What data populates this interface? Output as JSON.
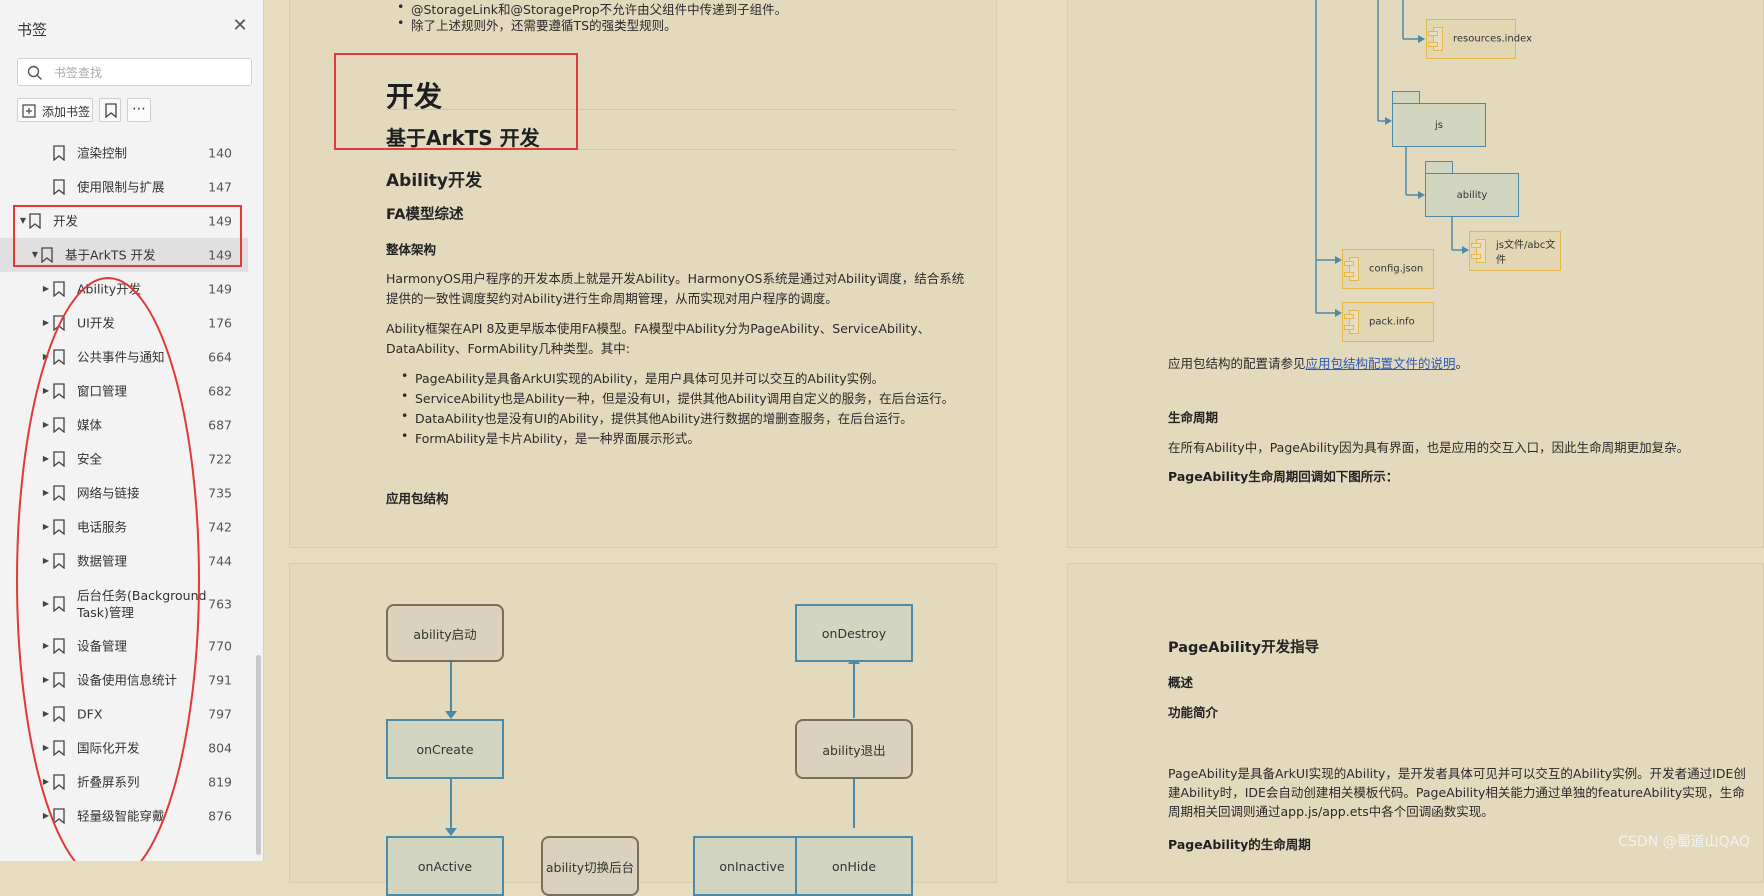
{
  "sidebar": {
    "title": "书签",
    "close_icon": "close-icon",
    "search_placeholder": "书签查找",
    "toolbar": {
      "add_label": "添加书签",
      "more_label": "⋯"
    },
    "items": [
      {
        "label": "渲染控制",
        "page": "140",
        "level": 1,
        "arrow": ""
      },
      {
        "label": "使用限制与扩展",
        "page": "147",
        "level": 1,
        "arrow": ""
      },
      {
        "label": "开发",
        "page": "149",
        "level": 0,
        "arrow": "▼"
      },
      {
        "label": "基于ArkTS 开发",
        "page": "149",
        "level": 1,
        "arrow": "▼",
        "selected": true
      },
      {
        "label": "Ability开发",
        "page": "149",
        "level": 2,
        "arrow": "▶"
      },
      {
        "label": "UI开发",
        "page": "176",
        "level": 2,
        "arrow": "▶"
      },
      {
        "label": "公共事件与通知",
        "page": "664",
        "level": 2,
        "arrow": "▶"
      },
      {
        "label": "窗口管理",
        "page": "682",
        "level": 2,
        "arrow": "▶"
      },
      {
        "label": "媒体",
        "page": "687",
        "level": 2,
        "arrow": "▶"
      },
      {
        "label": "安全",
        "page": "722",
        "level": 2,
        "arrow": "▶"
      },
      {
        "label": "网络与链接",
        "page": "735",
        "level": 2,
        "arrow": "▶"
      },
      {
        "label": "电话服务",
        "page": "742",
        "level": 2,
        "arrow": "▶"
      },
      {
        "label": "数据管理",
        "page": "744",
        "level": 2,
        "arrow": "▶"
      },
      {
        "label": "后台任务(Background",
        "label2": "Task)管理",
        "page": "763",
        "level": 2,
        "arrow": "▶"
      },
      {
        "label": "设备管理",
        "page": "770",
        "level": 2,
        "arrow": "▶"
      },
      {
        "label": "设备使用信息统计",
        "page": "791",
        "level": 2,
        "arrow": "▶"
      },
      {
        "label": "DFX",
        "page": "797",
        "level": 2,
        "arrow": "▶"
      },
      {
        "label": "国际化开发",
        "page": "804",
        "level": 2,
        "arrow": "▶"
      },
      {
        "label": "折叠屏系列",
        "page": "819",
        "level": 2,
        "arrow": "▶"
      },
      {
        "label": "轻量级智能穿戴",
        "page": "876",
        "level": 2,
        "arrow": "▶"
      }
    ]
  },
  "page1": {
    "top_line1": "@StorageLink和@StorageProp不允许由父组件中传递到子组件。",
    "top_line2": "除了上述规则外，还需要遵循TS的强类型规则。",
    "h_dev": "开发",
    "h_arkts": "基于ArkTS 开发",
    "h_ability": "Ability开发",
    "h_fa": "FA模型综述",
    "h_arch": "整体架构",
    "p1_l1": "HarmonyOS用户程序的开发本质上就是开发Ability。HarmonyOS系统是通过对Ability调度，结合系统",
    "p1_l2": "提供的一致性调度契约对Ability进行生命周期管理，从而实现对用户程序的调度。",
    "p2_l1": "Ability框架在API 8及更早版本使用FA模型。FA模型中Ability分为PageAbility、ServiceAbility、",
    "p2_l2": "DataAbility、FormAbility几种类型。其中:",
    "bullets": [
      "PageAbility是具备ArkUI实现的Ability，是用户具体可见并可以交互的Ability实例。",
      "ServiceAbility也是Ability一种，但是没有UI，提供其他Ability调用自定义的服务，在后台运行。",
      "DataAbility也是没有UI的Ability，提供其他Ability进行数据的增删查服务，在后台运行。",
      "FormAbility是卡片Ability，是一种界面展示形式。"
    ],
    "h_pkg": "应用包结构"
  },
  "page2": {
    "nodes": {
      "resources_index": "resources.index",
      "js": "js",
      "ability": "ability",
      "config": "config.json",
      "abc": "js文件/abc文件",
      "pack": "pack.info"
    },
    "pkg_note_prefix": "应用包结构的配置请参见",
    "pkg_note_link": "应用包结构配置文件的说明",
    "pkg_note_suffix": "。",
    "h_lifecycle": "生命周期",
    "lifecycle_text": "在所有Ability中，PageAbility因为具有界面，也是应用的交互入口，因此生命周期更加复杂。",
    "lifecycle_fig": "PageAbility生命周期回调如下图所示："
  },
  "page3": {
    "nodes": {
      "start": "ability启动",
      "create": "onCreate",
      "destroy": "onDestroy",
      "exit": "ability退出",
      "b1": "onActive",
      "b2": "ability切换后台",
      "b3": "onInactive",
      "b4": "onHide"
    }
  },
  "page4": {
    "h_guide": "PageAbility开发指导",
    "h_overview": "概述",
    "h_intro": "功能简介",
    "p_l1": "PageAbility是具备ArkUI实现的Ability，是开发者具体可见并可以交互的Ability实例。开发者通过IDE创",
    "p_l2": "建Ability时，IDE会自动创建相关模板代码。PageAbility相关能力通过单独的featureAbility实现，生命",
    "p_l3": "周期相关回调则通过app.js/app.ets中各个回调函数实现。",
    "h_life": "PageAbility的生命周期"
  },
  "watermark": "CSDN @蜀道山QAQ",
  "colors": {
    "annotation": "#e03a3a",
    "link": "#2c59b8",
    "page_bg": "#e3d9bc"
  }
}
